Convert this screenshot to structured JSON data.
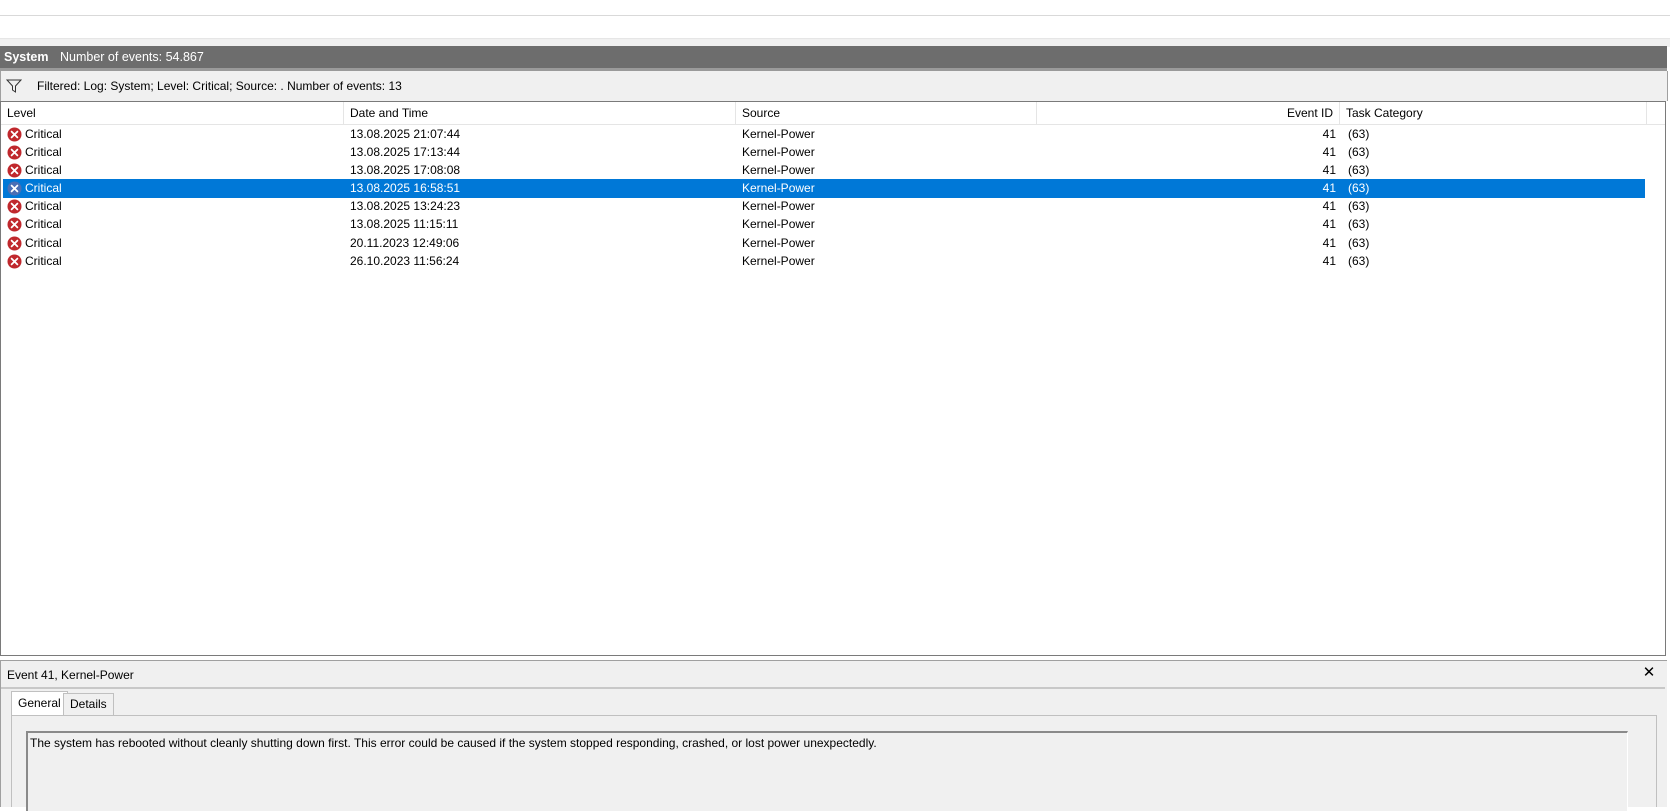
{
  "log_header": {
    "name": "System",
    "count_text": "Number of events: 54.867"
  },
  "filter": {
    "icon": "filter-icon",
    "text": "Filtered: Log: System; Level: Critical; Source: . Number of events: 13"
  },
  "columns": {
    "level": "Level",
    "date_time": "Date and Time",
    "source": "Source",
    "event_id": "Event ID",
    "task_category": "Task Category"
  },
  "events": [
    {
      "level": "Critical",
      "date_time": "13.08.2025 21:07:44",
      "source": "Kernel-Power",
      "event_id": "41",
      "task_category": "(63)",
      "selected": false
    },
    {
      "level": "Critical",
      "date_time": "13.08.2025 17:13:44",
      "source": "Kernel-Power",
      "event_id": "41",
      "task_category": "(63)",
      "selected": false
    },
    {
      "level": "Critical",
      "date_time": "13.08.2025 17:08:08",
      "source": "Kernel-Power",
      "event_id": "41",
      "task_category": "(63)",
      "selected": false
    },
    {
      "level": "Critical",
      "date_time": "13.08.2025 16:58:51",
      "source": "Kernel-Power",
      "event_id": "41",
      "task_category": "(63)",
      "selected": true
    },
    {
      "level": "Critical",
      "date_time": "13.08.2025 13:24:23",
      "source": "Kernel-Power",
      "event_id": "41",
      "task_category": "(63)",
      "selected": false
    },
    {
      "level": "Critical",
      "date_time": "13.08.2025 11:15:11",
      "source": "Kernel-Power",
      "event_id": "41",
      "task_category": "(63)",
      "selected": false
    },
    {
      "level": "Critical",
      "date_time": "20.11.2023 12:49:06",
      "source": "Kernel-Power",
      "event_id": "41",
      "task_category": "(63)",
      "selected": false
    },
    {
      "level": "Critical",
      "date_time": "26.10.2023 11:56:24",
      "source": "Kernel-Power",
      "event_id": "41",
      "task_category": "(63)",
      "selected": false
    }
  ],
  "details": {
    "title": "Event 41, Kernel-Power",
    "close_glyph": "✕",
    "tabs": [
      "General",
      "Details"
    ],
    "active_tab": "General",
    "description": "The system has rebooted without cleanly shutting down first. This error could be caused if the system stopped responding, crashed, or lost power unexpectedly."
  },
  "colors": {
    "selection": "#0078d7",
    "critical_icon": "#c0282d",
    "critical_icon_selected": "#4a6fb5",
    "header_band": "#6d6d6d"
  }
}
